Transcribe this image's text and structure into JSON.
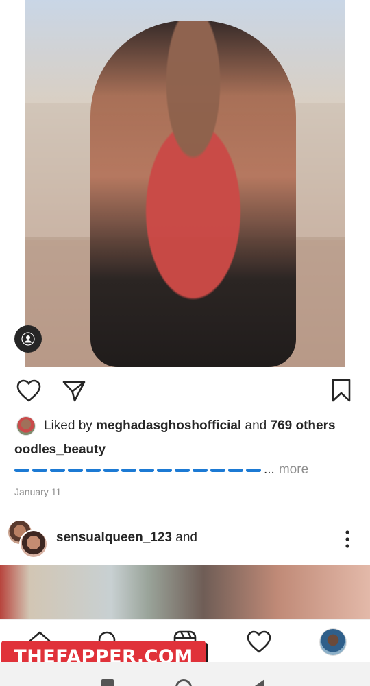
{
  "post": {
    "likes": {
      "prefix": "Liked by ",
      "user": "meghadasghoshofficial",
      "middle": " and ",
      "count": "769 others"
    },
    "caption_user": "oodles_beauty",
    "caption_ellipsis": "...",
    "more_label": "more",
    "date": "January 11"
  },
  "next_post": {
    "username": "sensualqueen_123",
    "suffix": " and"
  },
  "watermark": {
    "text": "THEFAPPER.COM"
  },
  "icons": {
    "like": "heart-outline-icon",
    "share": "paper-plane-icon",
    "save": "bookmark-icon",
    "tag": "person-tag-icon",
    "more": "kebab-icon",
    "home": "home-icon",
    "search": "search-icon",
    "reels": "reels-icon",
    "activity": "heart-icon",
    "profile": "profile-avatar"
  },
  "colors": {
    "link_blue": "#1c7ad4",
    "watermark_red": "#e0323a",
    "muted_text": "#8e8e8e"
  }
}
